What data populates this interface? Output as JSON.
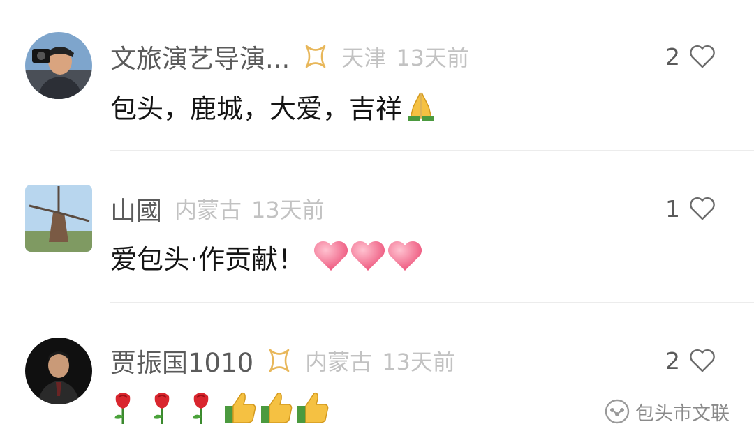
{
  "comments": [
    {
      "author": "文旅演艺导演...",
      "region": "天津",
      "time": "13天前",
      "likes": "2",
      "text": "包头，鹿城，大爱，吉祥",
      "emojis": [
        "folded-hands"
      ]
    },
    {
      "author": "山國",
      "region": "内蒙古",
      "time": "13天前",
      "likes": "1",
      "text": "爱包头·作贡献！",
      "emojis": [
        "pink-heart",
        "pink-heart",
        "pink-heart"
      ]
    },
    {
      "author": "贾振国1010",
      "region": "内蒙古",
      "time": "13天前",
      "likes": "2",
      "text": "",
      "emojis": [
        "rose",
        "rose",
        "rose",
        "thumbs-up",
        "thumbs-up",
        "thumbs-up"
      ]
    }
  ],
  "watermark": {
    "text": "包头市文联",
    "icon": "wechat-official-account-icon"
  },
  "colors": {
    "author": "#5b5b5b",
    "meta": "#c2c2c2",
    "text": "#141414",
    "divider": "#ececec",
    "badge": "#e8b75a",
    "heart-emoji": "#f06a8a"
  }
}
